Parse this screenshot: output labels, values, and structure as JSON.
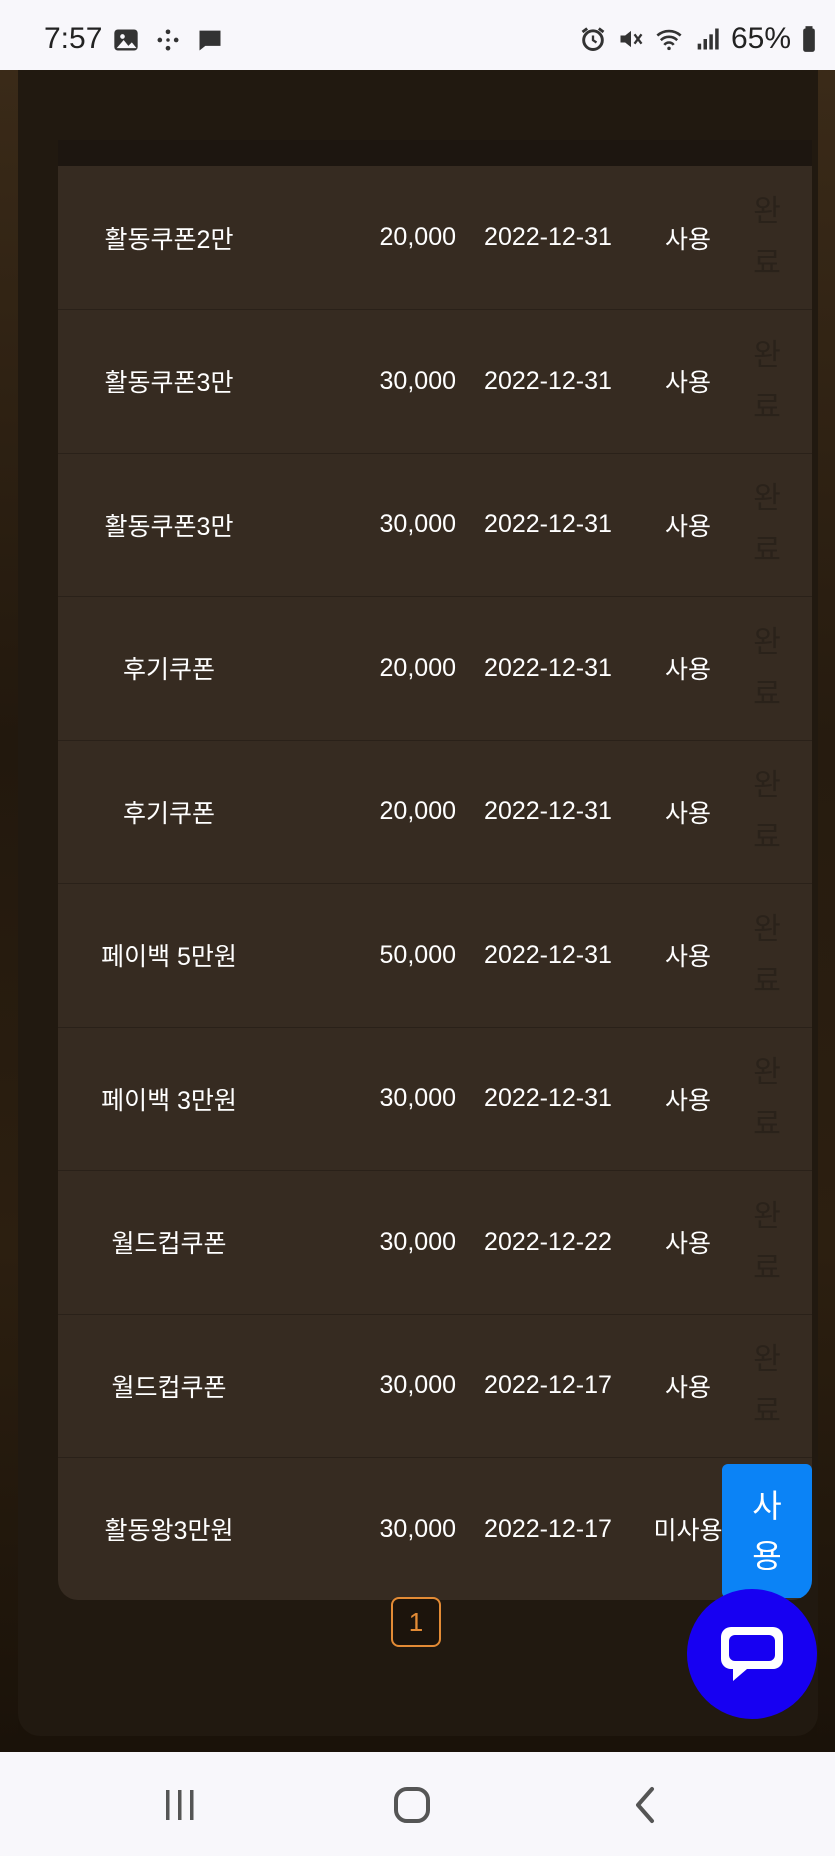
{
  "status_bar": {
    "time": "7:57",
    "battery": "65%",
    "left_icons": [
      "gallery-icon",
      "dots-icon",
      "message-icon"
    ],
    "right_icons": [
      "alarm-icon",
      "mute-icon",
      "wifi-icon",
      "signal-icon",
      "battery-icon"
    ]
  },
  "coupons": [
    {
      "name": "활동쿠폰2만",
      "amount": "20,000",
      "date": "2022-12-31",
      "status": "사용",
      "action": [
        "완",
        "료"
      ]
    },
    {
      "name": "활동쿠폰3만",
      "amount": "30,000",
      "date": "2022-12-31",
      "status": "사용",
      "action": [
        "완",
        "료"
      ]
    },
    {
      "name": "활동쿠폰3만",
      "amount": "30,000",
      "date": "2022-12-31",
      "status": "사용",
      "action": [
        "완",
        "료"
      ]
    },
    {
      "name": "후기쿠폰",
      "amount": "20,000",
      "date": "2022-12-31",
      "status": "사용",
      "action": [
        "완",
        "료"
      ]
    },
    {
      "name": "후기쿠폰",
      "amount": "20,000",
      "date": "2022-12-31",
      "status": "사용",
      "action": [
        "완",
        "료"
      ]
    },
    {
      "name": "페이백 5만원",
      "amount": "50,000",
      "date": "2022-12-31",
      "status": "사용",
      "action": [
        "완",
        "료"
      ]
    },
    {
      "name": "페이백 3만원",
      "amount": "30,000",
      "date": "2022-12-31",
      "status": "사용",
      "action": [
        "완",
        "료"
      ]
    },
    {
      "name": "월드컵쿠폰",
      "amount": "30,000",
      "date": "2022-12-22",
      "status": "사용",
      "action": [
        "완",
        "료"
      ]
    },
    {
      "name": "월드컵쿠폰",
      "amount": "30,000",
      "date": "2022-12-17",
      "status": "사용",
      "action": [
        "완",
        "료"
      ]
    },
    {
      "name": "활동왕3만원",
      "amount": "30,000",
      "date": "2022-12-17",
      "status": "미사용",
      "action": [
        "사",
        "용"
      ]
    }
  ],
  "pagination": {
    "current": "1"
  },
  "colors": {
    "use_button": "#0b83f6",
    "pager_accent": "#e38b35",
    "chat_fab": "#1700f2"
  },
  "nav_bar": {
    "icons": [
      "recent-apps-icon",
      "home-icon",
      "back-icon"
    ]
  }
}
